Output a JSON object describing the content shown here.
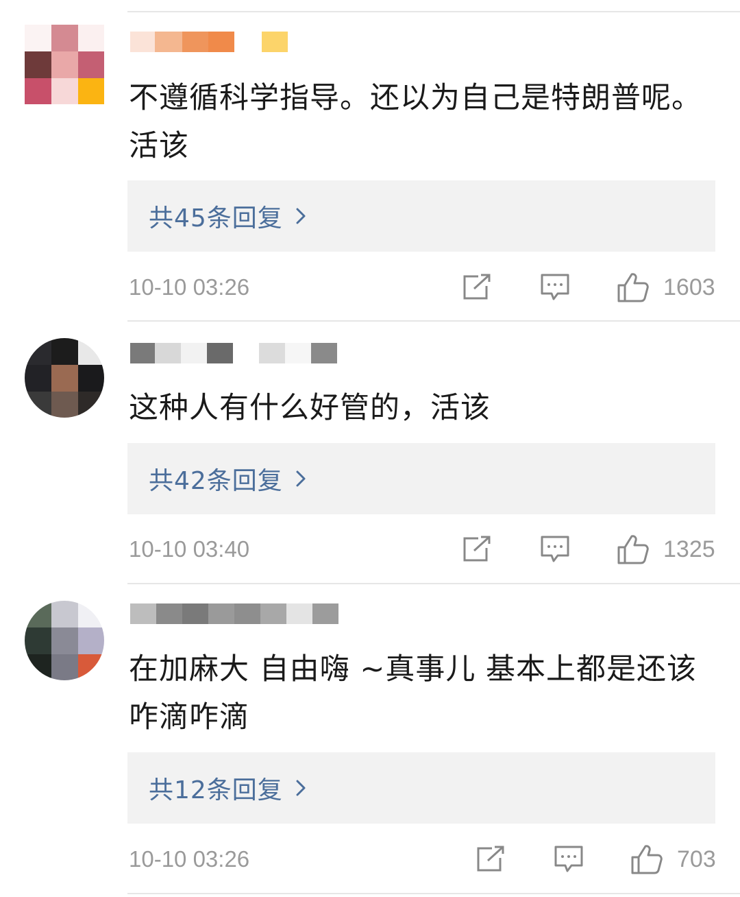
{
  "comments": [
    {
      "username": "",
      "text": "不遵循科学指导。还以为自己是特朗普呢。活该",
      "reply_label": "共45条回复",
      "timestamp": "10-10 03:26",
      "likes": "1603",
      "share_icon": "share-external-icon",
      "comment_icon": "comment-bubble-icon",
      "like_icon": "thumbs-up-icon"
    },
    {
      "username": "",
      "text": "这种人有什么好管的，活该",
      "reply_label": "共42条回复",
      "timestamp": "10-10 03:40",
      "likes": "1325",
      "share_icon": "share-external-icon",
      "comment_icon": "comment-bubble-icon",
      "like_icon": "thumbs-up-icon"
    },
    {
      "username": "",
      "text": "在加麻大 自由嗨 ~真事儿 基本上都是还该咋滴咋滴",
      "reply_label": "共12条回复",
      "timestamp": "10-10 03:26",
      "likes": "703",
      "share_icon": "share-external-icon",
      "comment_icon": "comment-bubble-icon",
      "like_icon": "thumbs-up-icon"
    }
  ],
  "colors": {
    "reply_link": "#4b6e9b",
    "reply_bg": "#f2f2f2",
    "meta_text": "#9a9a9a",
    "body_text": "#1a1a1a",
    "divider": "#e6e6e6"
  }
}
